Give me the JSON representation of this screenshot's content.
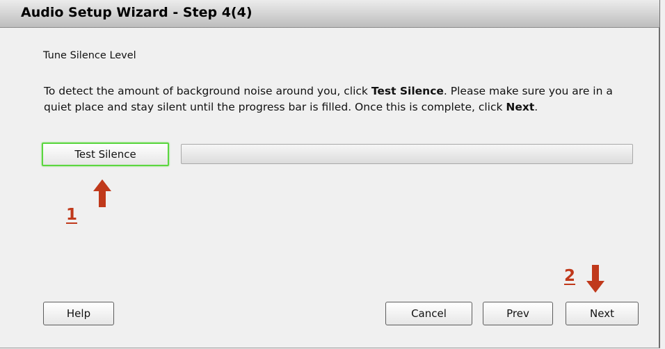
{
  "window": {
    "title": "Audio Setup Wizard - Step 4(4)"
  },
  "section": {
    "title": "Tune Silence Level"
  },
  "description": {
    "part1": "To detect the amount of background noise around you, click ",
    "bold1": "Test Silence",
    "part2": ". Please make sure you are in a quiet place and stay silent until the progress bar is filled. Once this is complete, click ",
    "bold2": "Next",
    "part3": "."
  },
  "test_button": {
    "label": "Test Silence"
  },
  "progress": {
    "value": 0
  },
  "annotations": {
    "step1": "1",
    "step2": "2",
    "color": "#c0391b"
  },
  "footer": {
    "help_label": "Help",
    "cancel_label": "Cancel",
    "prev_label": "Prev",
    "next_label": "Next"
  },
  "colors": {
    "highlight_border": "#5bd640",
    "annotation": "#c0391b"
  }
}
